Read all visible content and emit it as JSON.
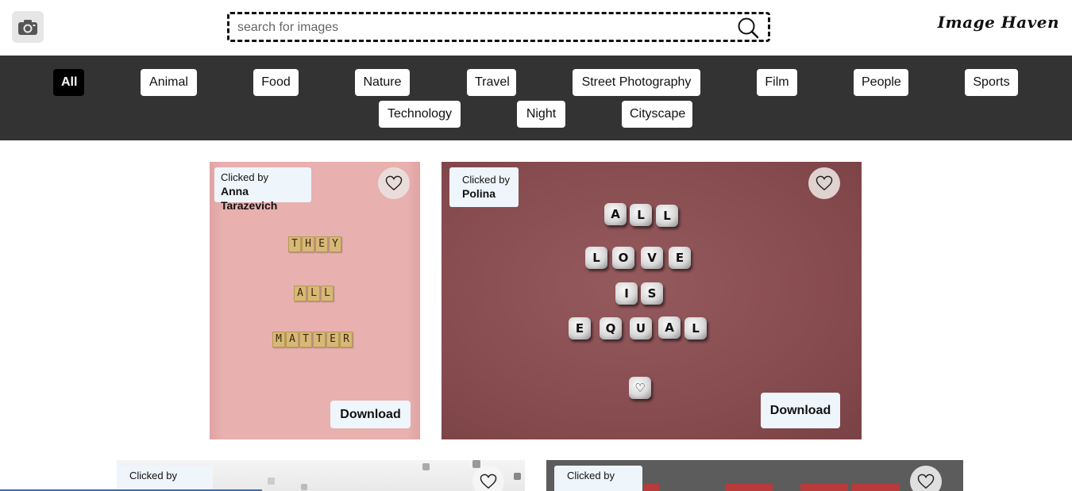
{
  "header": {
    "search_placeholder": "search for images",
    "brand": "Image Haven"
  },
  "categories": [
    {
      "label": "All",
      "active": true
    },
    {
      "label": "Animal"
    },
    {
      "label": "Food"
    },
    {
      "label": "Nature"
    },
    {
      "label": "Travel"
    },
    {
      "label": "Street Photography"
    },
    {
      "label": "Film"
    },
    {
      "label": "People"
    },
    {
      "label": "Sports"
    },
    {
      "label": "Technology"
    },
    {
      "label": "Night"
    },
    {
      "label": "Cityscape"
    }
  ],
  "cards": [
    {
      "clicked_by_label": "Clicked by",
      "author": "Anna Tarazevich",
      "download_label": "Download",
      "photo_text": [
        "THEY",
        "ALL",
        "MATTER"
      ]
    },
    {
      "clicked_by_label": "Clicked by",
      "author": "Polina",
      "download_label": "Download",
      "photo_text": [
        "ALL",
        "LOVE",
        "IS",
        "EQUAL"
      ]
    },
    {
      "clicked_by_label": "Clicked by",
      "author": ""
    },
    {
      "clicked_by_label": "Clicked by",
      "author": ""
    }
  ],
  "icons": {
    "logo": "camera-icon",
    "search": "search-icon",
    "favorite": "heart-outline-icon"
  },
  "colors": {
    "category_bar": "#333333",
    "chip_active": "#000000",
    "credit_bg": "#eef5fb",
    "card1_bg": "#e6aaa9",
    "card2_bg": "#8b4f53"
  }
}
